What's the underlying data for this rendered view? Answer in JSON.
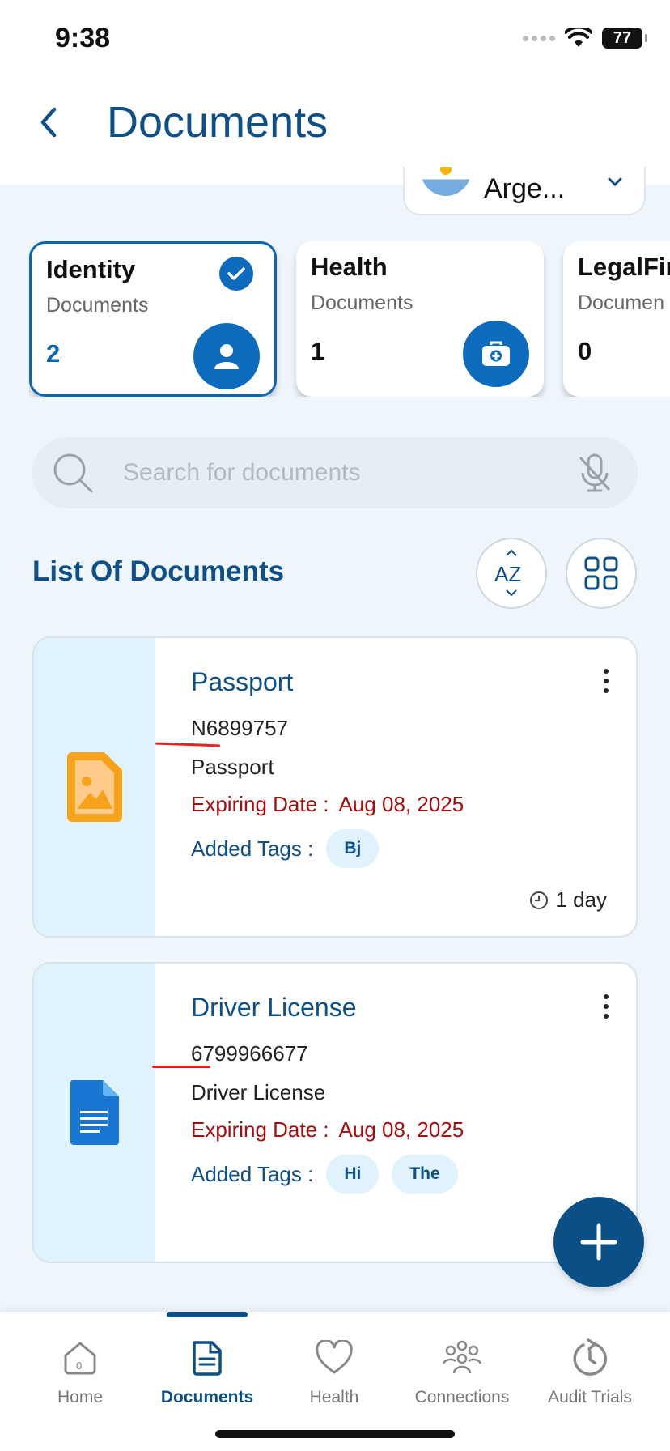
{
  "status_bar": {
    "time": "9:38",
    "battery": "77"
  },
  "header": {
    "title": "Documents"
  },
  "country_selector": {
    "value": "Arge..."
  },
  "categories": [
    {
      "title": "Identity",
      "subtitle": "Documents",
      "count": "2",
      "selected": true,
      "icon": "person-icon"
    },
    {
      "title": "Health",
      "subtitle": "Documents",
      "count": "1",
      "selected": false,
      "icon": "medical-kit-icon"
    },
    {
      "title": "LegalFin",
      "subtitle": "Documen",
      "count": "0",
      "selected": false,
      "icon": ""
    }
  ],
  "search": {
    "placeholder": "Search for documents"
  },
  "list": {
    "title": "List Of Documents",
    "sort_label": "AZ"
  },
  "documents": [
    {
      "name": "Passport",
      "number": "N6899757",
      "type": "Passport",
      "expiry_label": "Expiring Date :",
      "expiry_value": "Aug 08, 2025",
      "tags_label": "Added Tags :",
      "tags": [
        "Bj"
      ],
      "time": "1 day",
      "file_icon": "image-file-icon"
    },
    {
      "name": "Driver License",
      "number": "6799966677",
      "type": "Driver License",
      "expiry_label": "Expiring Date :",
      "expiry_value": "Aug 08, 2025",
      "tags_label": "Added Tags :",
      "tags": [
        "Hi",
        "The"
      ],
      "time": "",
      "file_icon": "document-file-icon"
    }
  ],
  "bottom_nav": [
    {
      "label": "Home",
      "icon": "home-icon",
      "active": false
    },
    {
      "label": "Documents",
      "icon": "document-icon",
      "active": true
    },
    {
      "label": "Health",
      "icon": "heart-icon",
      "active": false
    },
    {
      "label": "Connections",
      "icon": "people-icon",
      "active": false
    },
    {
      "label": "Audit Trials",
      "icon": "history-icon",
      "active": false
    }
  ],
  "colors": {
    "primary": "#0D4F86",
    "accent": "#0D6BBE",
    "expiry_red": "#A60D0D",
    "background": "#EEF5FB",
    "tag_bg": "#E0F2FC"
  }
}
